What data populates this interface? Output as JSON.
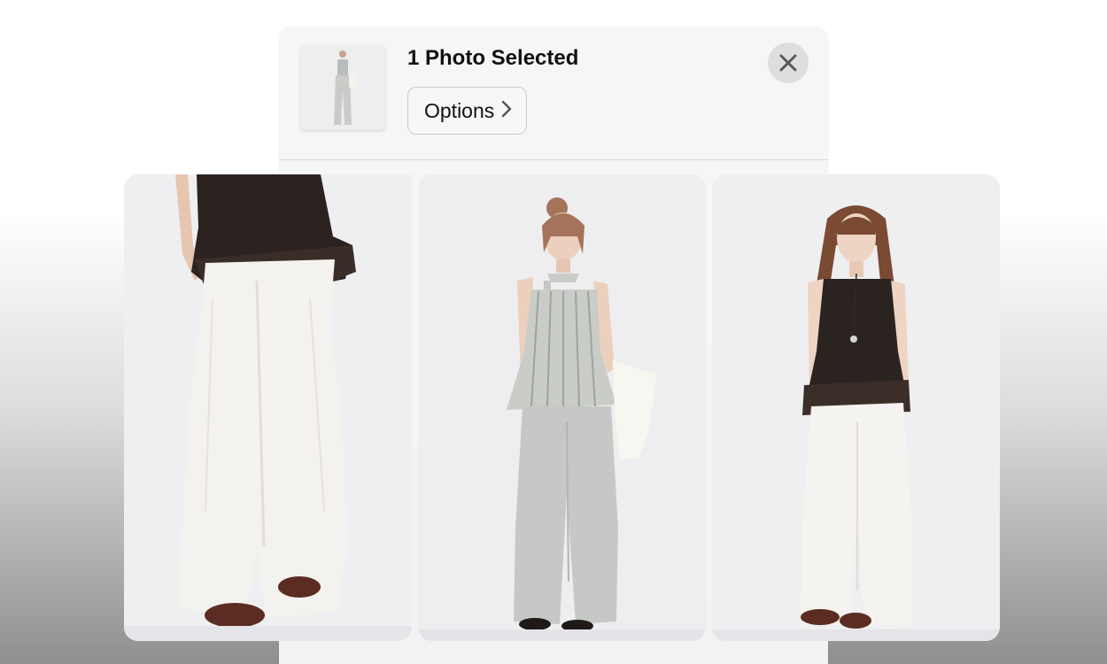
{
  "share_sheet": {
    "title": "1 Photo Selected",
    "options_label": "Options",
    "options_chevron": "chevron-right-icon",
    "close_icon": "close-icon"
  },
  "photos": [
    {
      "name": "photo-1",
      "description_icon": "photo"
    },
    {
      "name": "photo-2",
      "description_icon": "photo"
    },
    {
      "name": "photo-3",
      "description_icon": "photo"
    }
  ],
  "colors": {
    "sheet_bg": "#f6f6f6",
    "close_bg": "#dedede",
    "text": "#111111"
  }
}
